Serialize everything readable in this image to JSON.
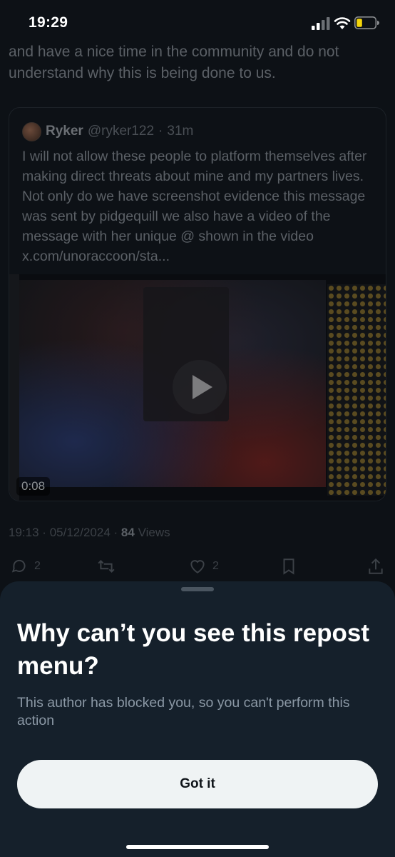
{
  "status_bar": {
    "time": "19:29"
  },
  "tweet": {
    "text": "and have a nice time in the community and do not understand why this is being done to us.",
    "quote": {
      "name": "Ryker",
      "handle": "@ryker122",
      "separator": "·",
      "age": "31m",
      "text": "I will not allow these people to platform themselves after making direct threats about mine and my partners lives. Not only do we have screenshot evidence this message was sent by pidgequill we also have a video of the message with her unique @ shown in the video x.com/unoraccoon/sta...",
      "video_duration": "0:08"
    },
    "meta": {
      "time": "19:13",
      "separator": "·",
      "date": "05/12/2024",
      "views_count": "84",
      "views_label": "Views"
    },
    "actions": {
      "replies": "2",
      "likes": "2"
    }
  },
  "sheet": {
    "title": "Why can’t you see this repost menu?",
    "message": "This author has blocked you, so you can't perform this action",
    "button_label": "Got it"
  },
  "colors": {
    "sheet_bg": "#15202b",
    "button_bg": "#eff3f4",
    "text_secondary": "#8b98a5"
  }
}
